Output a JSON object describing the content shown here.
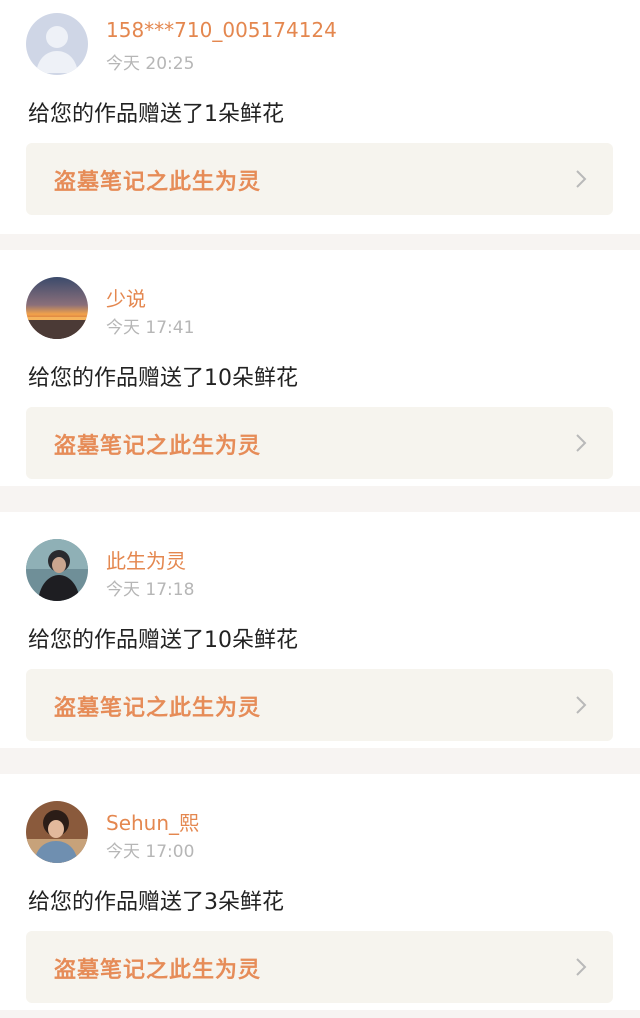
{
  "feed": {
    "items": [
      {
        "username": "158***710_005174124",
        "timestamp": "今天 20:25",
        "message": "给您的作品赠送了1朵鲜花",
        "work_title": "盗墓笔记之此生为灵",
        "avatar_icon": "default-user-avatar-icon"
      },
      {
        "username": "少说",
        "timestamp": "今天 17:41",
        "message": "给您的作品赠送了10朵鲜花",
        "work_title": "盗墓笔记之此生为灵",
        "avatar_icon": "sunset-landscape-avatar"
      },
      {
        "username": "此生为灵",
        "timestamp": "今天 17:18",
        "message": "给您的作品赠送了10朵鲜花",
        "work_title": "盗墓笔记之此生为灵",
        "avatar_icon": "person-dark-jacket-avatar"
      },
      {
        "username": "Sehun_熙",
        "timestamp": "今天 17:00",
        "message": "给您的作品赠送了3朵鲜花",
        "work_title": "盗墓笔记之此生为灵",
        "avatar_icon": "person-photo-avatar"
      }
    ]
  },
  "colors": {
    "accent": "#e4874f",
    "page_background": "#f7f4f2",
    "card_background": "#ffffff",
    "link_background": "#f6f4ee",
    "message_text": "#222222",
    "timestamp_text": "#b6b6b6"
  }
}
